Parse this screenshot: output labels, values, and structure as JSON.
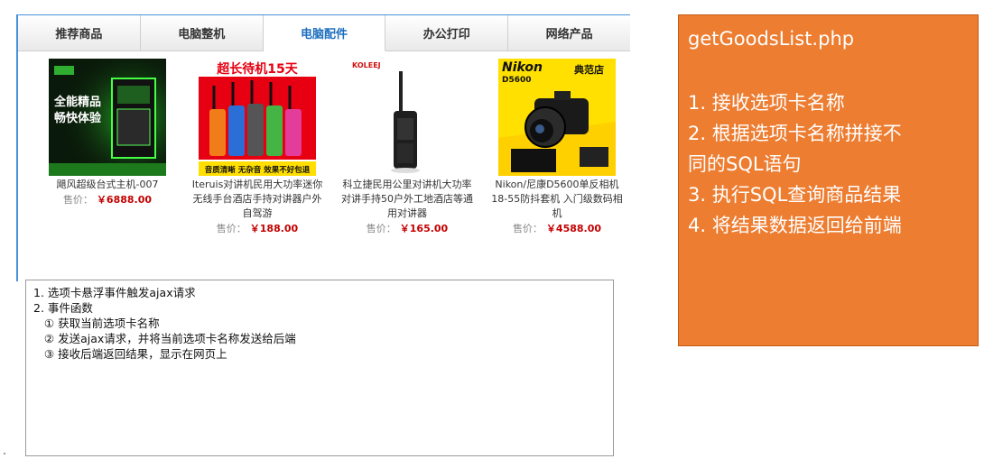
{
  "tabs": [
    {
      "label": "推荐商品",
      "active": false
    },
    {
      "label": "电脑整机",
      "active": false
    },
    {
      "label": "电脑配件",
      "active": true
    },
    {
      "label": "办公打印",
      "active": false
    },
    {
      "label": "网络产品",
      "active": false
    }
  ],
  "products": [
    {
      "name_lines": [
        "飓风超级台式主机-007"
      ],
      "price_label": "售价：",
      "price": "￥6888.00",
      "image": "desktop-pc-green-banner"
    },
    {
      "name_lines": [
        "Iteruis对讲机民用大功率迷你",
        "无线手台酒店手持对讲器户外",
        "自驾游"
      ],
      "price_label": "售价：",
      "price": "￥188.00",
      "image": "walkie-talkies-banner"
    },
    {
      "name_lines": [
        "科立捷民用公里对讲机大功率",
        "对讲手持50户外工地酒店等通",
        "用对讲器"
      ],
      "price_label": "售价：",
      "price": "￥165.00",
      "image": "single-walkie-talkie"
    },
    {
      "name_lines": [
        "Nikon/尼康D5600单反相机",
        "18-55防抖套机 入门级数码相",
        "机"
      ],
      "price_label": "售价：",
      "price": "￥4588.00",
      "image": "nikon-camera-banner"
    }
  ],
  "notes": [
    "1. 选项卡悬浮事件触发ajax请求",
    "2. 事件函数",
    "   ① 获取当前选项卡名称",
    "   ② 发送ajax请求，并将当前选项卡名称发送给后端",
    "   ③ 接收后端返回结果，显示在网页上"
  ],
  "callout": {
    "title": "getGoodsList.php",
    "steps": [
      " 1. 接收选项卡名称",
      " 2. 根据选项卡名称拼接不",
      "同的SQL语句",
      " 3. 执行SQL查询商品结果",
      " 4. 将结果数据返回给前端"
    ]
  },
  "banner_text": {
    "pc_headline": "全能精品",
    "pc_sub": "畅快体验",
    "radio_headline": "超长待机15天",
    "radio_footer": "音质清晰 无杂音 效果不好包退",
    "brand_koleej": "KOLEEJ",
    "brand_nikon": "Nikon",
    "nikon_model": "D5600",
    "nikon_shop": "典范店"
  },
  "colors": {
    "accent": "#1f6fbf",
    "price": "#c40000",
    "callout_bg": "#ed7d31"
  }
}
